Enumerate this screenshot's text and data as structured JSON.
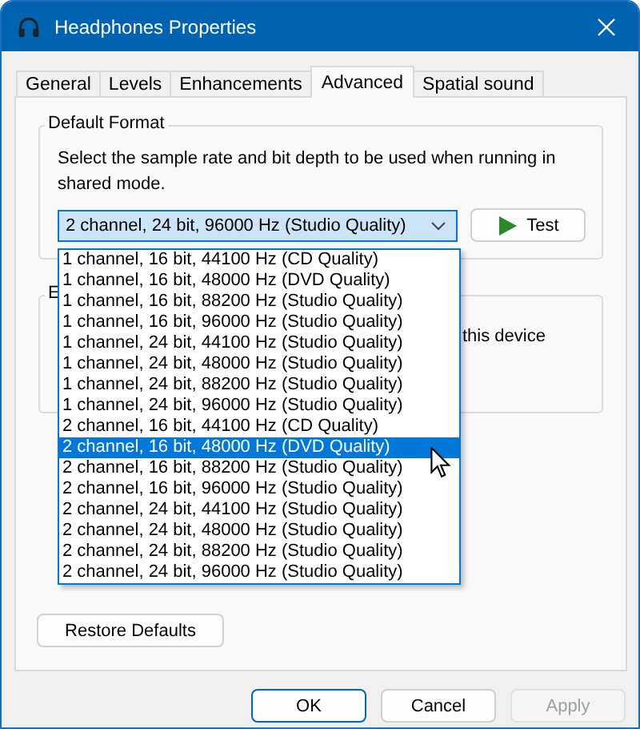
{
  "window": {
    "title": "Headphones Properties"
  },
  "tabs": [
    {
      "label": "General",
      "selected": false
    },
    {
      "label": "Levels",
      "selected": false
    },
    {
      "label": "Enhancements",
      "selected": false
    },
    {
      "label": "Advanced",
      "selected": true
    },
    {
      "label": "Spatial sound",
      "selected": false
    }
  ],
  "default_format": {
    "label": "Default Format",
    "description": "Select the sample rate and bit depth to be used when running in shared mode.",
    "combo": {
      "value": "2 channel, 24 bit, 96000 Hz (Studio Quality)",
      "expanded": true
    },
    "options": [
      {
        "label": "1 channel, 16 bit, 44100 Hz (CD Quality)",
        "selected": false
      },
      {
        "label": "1 channel, 16 bit, 48000 Hz (DVD Quality)",
        "selected": false
      },
      {
        "label": "1 channel, 16 bit, 88200 Hz (Studio Quality)",
        "selected": false
      },
      {
        "label": "1 channel, 16 bit, 96000 Hz (Studio Quality)",
        "selected": false
      },
      {
        "label": "1 channel, 24 bit, 44100 Hz (Studio Quality)",
        "selected": false
      },
      {
        "label": "1 channel, 24 bit, 48000 Hz (Studio Quality)",
        "selected": false
      },
      {
        "label": "1 channel, 24 bit, 88200 Hz (Studio Quality)",
        "selected": false
      },
      {
        "label": "1 channel, 24 bit, 96000 Hz (Studio Quality)",
        "selected": false
      },
      {
        "label": "2 channel, 16 bit, 44100 Hz (CD Quality)",
        "selected": false
      },
      {
        "label": "2 channel, 16 bit, 48000 Hz (DVD Quality)",
        "selected": true
      },
      {
        "label": "2 channel, 16 bit, 88200 Hz (Studio Quality)",
        "selected": false
      },
      {
        "label": "2 channel, 16 bit, 96000 Hz (Studio Quality)",
        "selected": false
      },
      {
        "label": "2 channel, 24 bit, 44100 Hz (Studio Quality)",
        "selected": false
      },
      {
        "label": "2 channel, 24 bit, 48000 Hz (Studio Quality)",
        "selected": false
      },
      {
        "label": "2 channel, 24 bit, 88200 Hz (Studio Quality)",
        "selected": false
      },
      {
        "label": "2 channel, 24 bit, 96000 Hz (Studio Quality)",
        "selected": false
      }
    ],
    "test_button": "Test"
  },
  "second_group": {
    "label": "E",
    "text": "this device"
  },
  "restore_button": "Restore Defaults",
  "buttons": [
    {
      "label": "OK",
      "kind": "default",
      "disabled": false
    },
    {
      "label": "Cancel",
      "kind": "normal",
      "disabled": false
    },
    {
      "label": "Apply",
      "kind": "normal",
      "disabled": true
    }
  ]
}
